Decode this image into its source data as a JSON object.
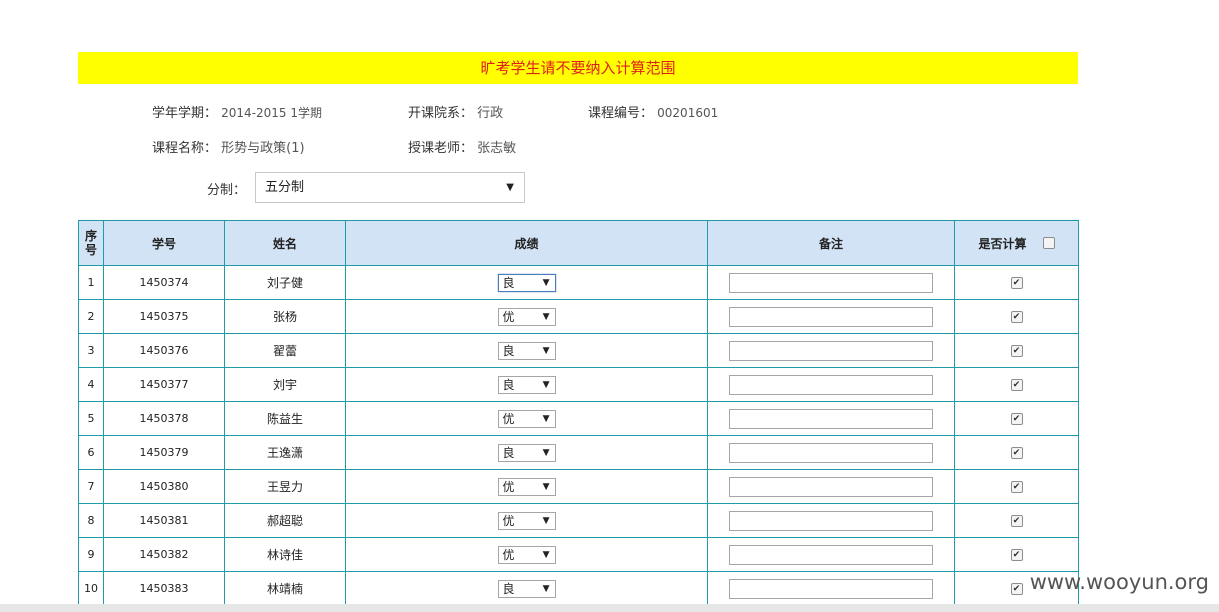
{
  "banner": "旷考学生请不要纳入计算范围",
  "info": {
    "term_label": "学年学期：",
    "term_value": "2014-2015 1学期",
    "dept_label": "开课院系：",
    "dept_value": "行政",
    "course_no_label": "课程编号：",
    "course_no_value": "00201601",
    "course_name_label": "课程名称：",
    "course_name_value": "形势与政策(1)",
    "teacher_label": "授课老师：",
    "teacher_value": "张志敏"
  },
  "scale": {
    "label": "分制：",
    "value": "五分制",
    "arrow": "▼"
  },
  "table": {
    "headers": {
      "idx": "序号",
      "sid": "学号",
      "name": "姓名",
      "grade": "成绩",
      "remark": "备注",
      "count": "是否计算"
    },
    "rows": [
      {
        "idx": "1",
        "sid": "1450374",
        "name": "刘子健",
        "grade": "良"
      },
      {
        "idx": "2",
        "sid": "1450375",
        "name": "张杨",
        "grade": "优"
      },
      {
        "idx": "3",
        "sid": "1450376",
        "name": "翟蕾",
        "grade": "良"
      },
      {
        "idx": "4",
        "sid": "1450377",
        "name": "刘宇",
        "grade": "良"
      },
      {
        "idx": "5",
        "sid": "1450378",
        "name": "陈益生",
        "grade": "优"
      },
      {
        "idx": "6",
        "sid": "1450379",
        "name": "王逸潇",
        "grade": "良"
      },
      {
        "idx": "7",
        "sid": "1450380",
        "name": "王昱力",
        "grade": "优"
      },
      {
        "idx": "8",
        "sid": "1450381",
        "name": "郝超聪",
        "grade": "优"
      },
      {
        "idx": "9",
        "sid": "1450382",
        "name": "林诗佳",
        "grade": "优"
      },
      {
        "idx": "10",
        "sid": "1450383",
        "name": "林靖楠",
        "grade": "良"
      }
    ],
    "check_mark": "✔",
    "arrow": "▼"
  },
  "watermark": "www.wooyun.org"
}
